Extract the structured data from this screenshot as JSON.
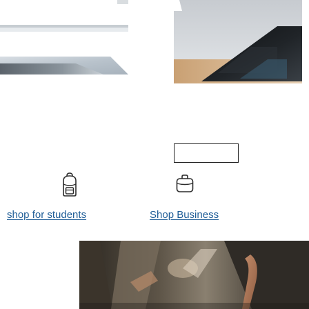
{
  "categories": [
    {
      "id": "students",
      "label": "shop for students",
      "icon": "backpack-icon"
    },
    {
      "id": "business",
      "label": "Shop Business",
      "icon": "briefcase-icon"
    }
  ],
  "colors": {
    "link": "#1f5d97",
    "icon_stroke": "#2b2b2b",
    "background": "#ffffff"
  }
}
